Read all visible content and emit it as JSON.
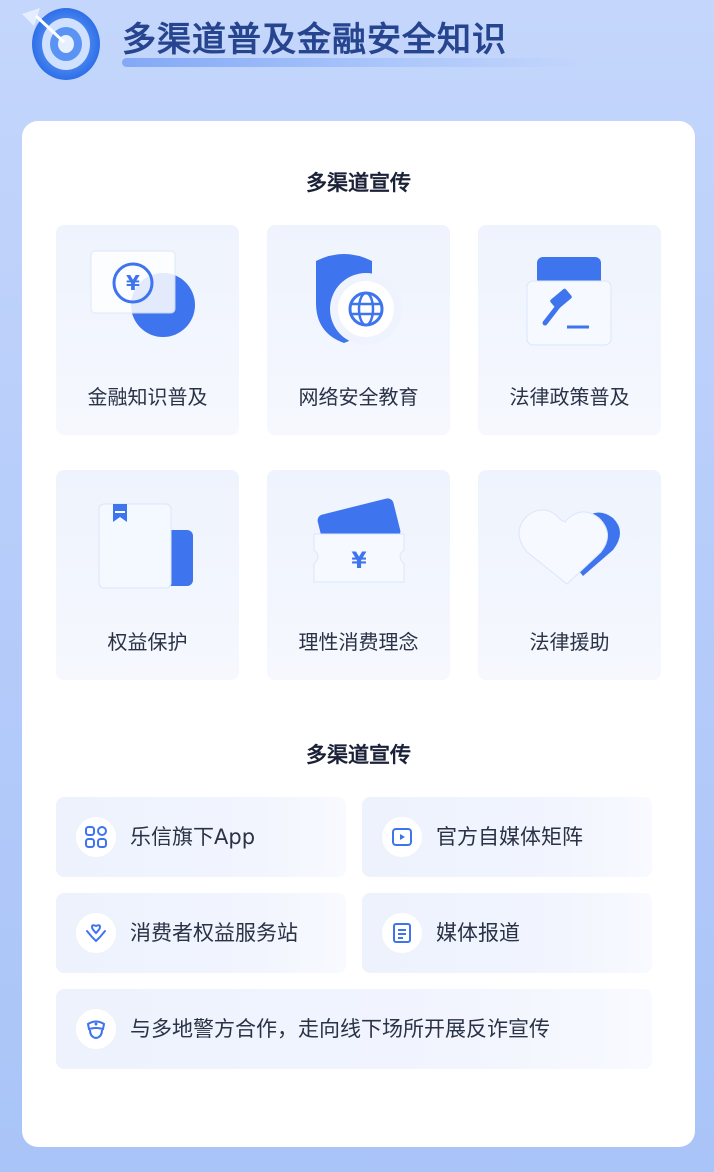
{
  "header": {
    "title": "多渠道普及金融安全知识"
  },
  "section1": {
    "title": "多渠道宣传",
    "tiles": [
      {
        "label": "金融知识普及",
        "icon": "yuan-coin-icon"
      },
      {
        "label": "网络安全教育",
        "icon": "shield-globe-icon"
      },
      {
        "label": "法律政策普及",
        "icon": "gavel-icon"
      },
      {
        "label": "权益保护",
        "icon": "book-bookmark-icon"
      },
      {
        "label": "理性消费理念",
        "icon": "yuan-ticket-icon"
      },
      {
        "label": "法律援助",
        "icon": "heart-icon"
      }
    ]
  },
  "section2": {
    "title": "多渠道宣传",
    "items": [
      {
        "label": "乐信旗下App",
        "icon": "apps-grid-icon"
      },
      {
        "label": "官方自媒体矩阵",
        "icon": "video-play-icon"
      },
      {
        "label": "消费者权益服务站",
        "icon": "hand-heart-icon"
      },
      {
        "label": "媒体报道",
        "icon": "news-document-icon"
      },
      {
        "label": "与多地警方合作，走向线下场所开展反诈宣传",
        "icon": "police-badge-icon"
      }
    ]
  },
  "colors": {
    "accent_blue": "#3f74ef",
    "title_blue": "#27458f",
    "background": "#b7cdfa"
  }
}
